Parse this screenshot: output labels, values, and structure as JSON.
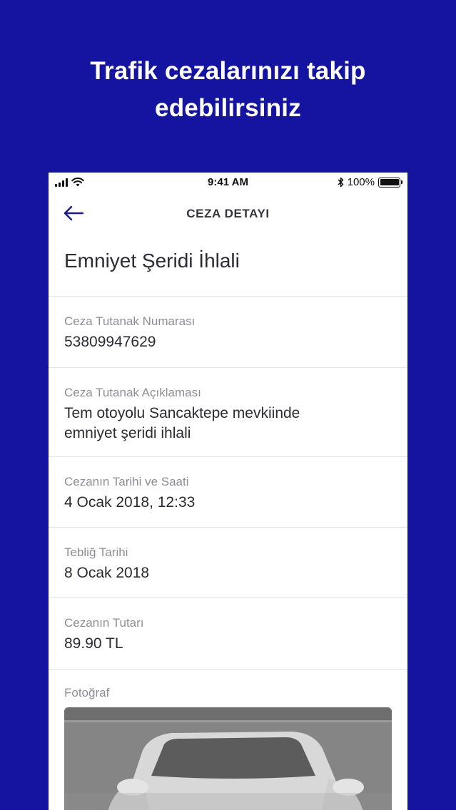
{
  "promo": {
    "title_line1": "Trafik cezalarınızı takip",
    "title_line2": "edebilirsiniz"
  },
  "status_bar": {
    "time": "9:41 AM",
    "battery": "100%"
  },
  "nav": {
    "title": "CEZA DETAYI"
  },
  "detail": {
    "title": "Emniyet Şeridi İhlali",
    "fields": [
      {
        "label": "Ceza Tutanak Numarası",
        "value": "53809947629"
      },
      {
        "label": "Ceza Tutanak Açıklaması",
        "value_line1": "Tem otoyolu Sancaktepe mevkiinde",
        "value_line2": "emniyet şeridi ihlali"
      },
      {
        "label": "Cezanın Tarihi ve Saati",
        "value": "4 Ocak 2018, 12:33"
      },
      {
        "label": "Tebliğ Tarihi",
        "value": "8 Ocak 2018"
      },
      {
        "label": "Cezanın Tutarı",
        "value": "89.90 TL"
      }
    ],
    "photo_label": "Fotoğraf"
  },
  "colors": {
    "background": "#1414a0",
    "accent": "#1b1b8c"
  },
  "icons": [
    "signal-icon",
    "wifi-icon",
    "bluetooth-icon",
    "battery-icon",
    "back-arrow-icon"
  ]
}
